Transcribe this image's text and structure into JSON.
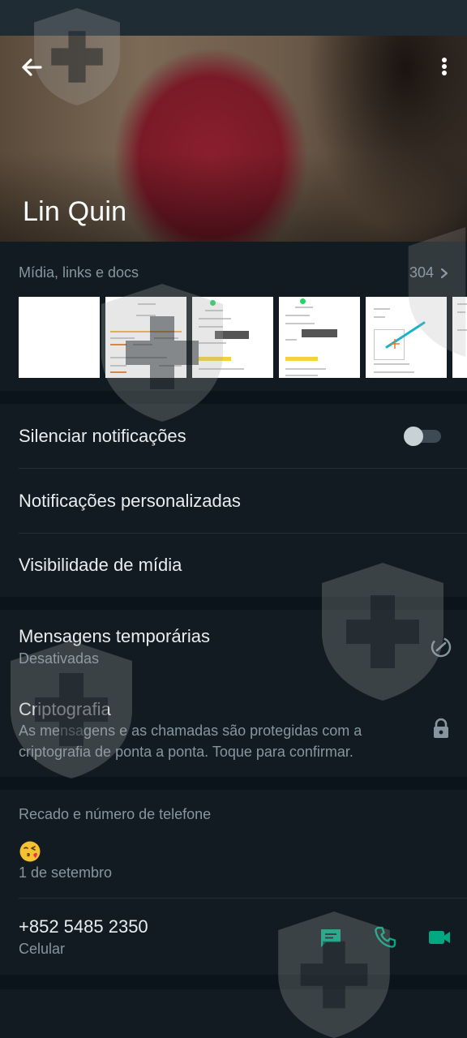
{
  "contact": {
    "name": "Lin Quin"
  },
  "media": {
    "title": "Mídia, links e docs",
    "count": "304"
  },
  "settings": {
    "mute_label": "Silenciar notificações",
    "custom_notifications_label": "Notificações personalizadas",
    "media_visibility_label": "Visibilidade de mídia"
  },
  "privacy": {
    "disappearing_label": "Mensagens temporárias",
    "disappearing_value": "Desativadas",
    "encryption_label": "Criptografia",
    "encryption_line1": "As mensagens e as chamadas são protegidas com a",
    "encryption_line2": "criptografia de ponta a ponta. Toque para confirmar."
  },
  "about": {
    "title": "Recado e número de telefone",
    "status_emoji": "face-throwing-kiss-emoji",
    "status_date": "1 de setembro",
    "phone": "+852 5485 2350",
    "phone_type": "Celular"
  },
  "colors": {
    "accent": "#00a884",
    "background": "#0b141a",
    "surface": "#111b21",
    "secondary_text": "#8696a0"
  }
}
